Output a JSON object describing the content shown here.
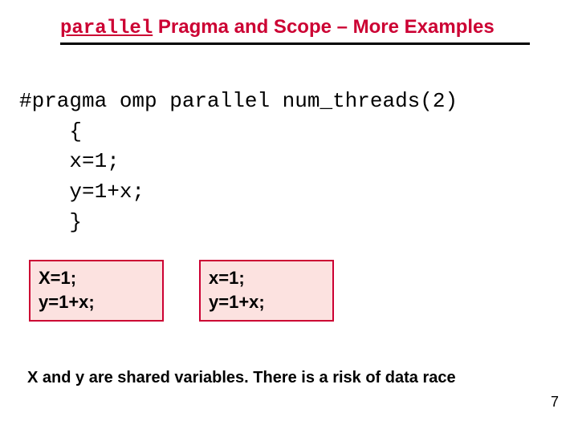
{
  "title": {
    "mono": "parallel",
    "rest": " Pragma and Scope – More Examples"
  },
  "code": {
    "line1": "#pragma omp parallel num_threads(2)",
    "line2": "    {",
    "line3": "    x=1;",
    "line4": "    y=1+x;",
    "line5": "    }"
  },
  "threads": [
    {
      "l1": "X=1;",
      "l2": "y=1+x;"
    },
    {
      "l1": "x=1;",
      "l2": "y=1+x;"
    }
  ],
  "note": "X and y are shared variables. There is a risk of data race",
  "page_number": "7"
}
